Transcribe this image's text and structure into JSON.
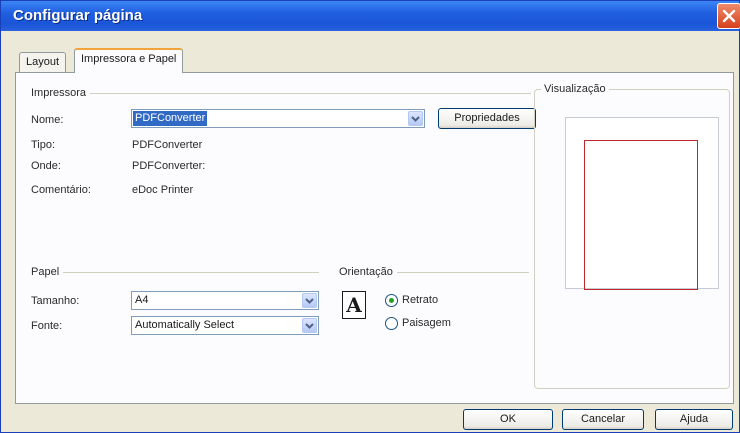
{
  "window": {
    "title": "Configurar página"
  },
  "tabs": [
    {
      "label": "Layout",
      "active": false
    },
    {
      "label": "Impressora e Papel",
      "active": true
    }
  ],
  "printer": {
    "section_label": "Impressora",
    "name_label": "Nome:",
    "name_value": "PDFConverter",
    "properties_button": "Propriedades",
    "type_label": "Tipo:",
    "type_value": "PDFConverter",
    "where_label": "Onde:",
    "where_value": "PDFConverter:",
    "comment_label": "Comentário:",
    "comment_value": "eDoc Printer"
  },
  "paper": {
    "section_label": "Papel",
    "size_label": "Tamanho:",
    "size_value": "A4",
    "source_label": "Fonte:",
    "source_value": "Automatically Select"
  },
  "orientation": {
    "section_label": "Orientação",
    "icon_glyph": "A",
    "portrait_label": "Retrato",
    "landscape_label": "Paisagem",
    "selected": "portrait"
  },
  "preview": {
    "label": "Visualização"
  },
  "buttons": {
    "ok": "OK",
    "cancel": "Cancelar",
    "help": "Ajuda"
  },
  "colors": {
    "titlebar": "#1f5fe0",
    "selection": "#316ac5",
    "preview_margin": "#c0282d",
    "radio_dot": "#21a121",
    "tab_highlight": "#f2a43c"
  },
  "icons": {
    "close": "close-icon",
    "dropdown": "chevron-down-icon",
    "orientation": "portrait-page-icon"
  }
}
